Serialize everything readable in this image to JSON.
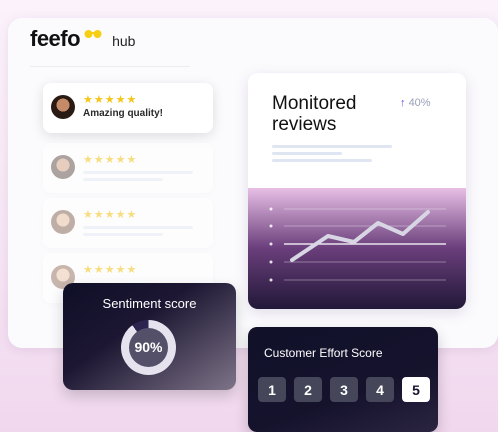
{
  "brand": {
    "logo": "feefo",
    "product": "hub"
  },
  "reviews": [
    {
      "stars": "★★★★★",
      "text": "Amazing quality!"
    },
    {
      "stars": "★★★★★",
      "text": ""
    },
    {
      "stars": "★★★★★",
      "text": ""
    },
    {
      "stars": "★★★★★",
      "text": ""
    }
  ],
  "monitored": {
    "title": "Monitored reviews",
    "delta_arrow": "↑",
    "delta": "40%"
  },
  "sentiment": {
    "title": "Sentiment score",
    "value": "90%",
    "fraction": 0.9
  },
  "ces": {
    "title": "Customer Effort Score",
    "options": [
      "1",
      "2",
      "3",
      "4",
      "5"
    ],
    "selected": "5"
  },
  "colors": {
    "star": "#f5c518",
    "accent_up": "#6b50d9"
  },
  "icons": {
    "logo_mark": "smile-eyes-icon",
    "trend": "up-arrow-icon"
  }
}
